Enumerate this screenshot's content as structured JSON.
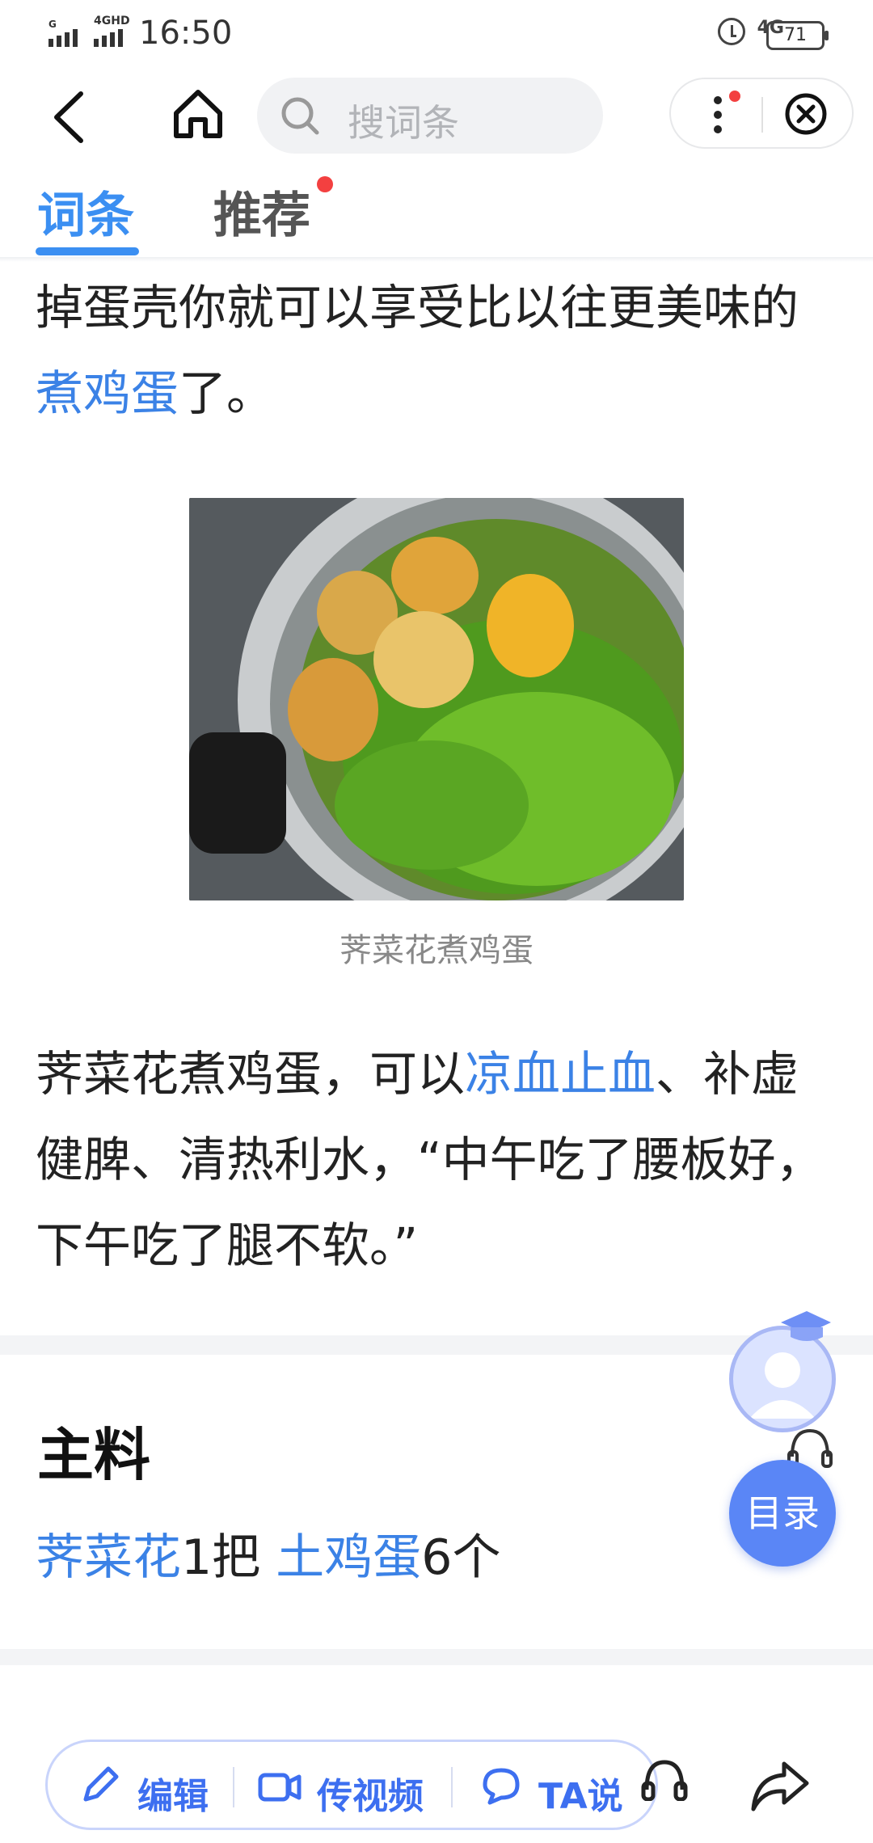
{
  "status_bar": {
    "time": "16:50",
    "signal_label": "4GHD",
    "network_label": "4G",
    "battery": "71"
  },
  "nav": {
    "search_placeholder": "搜词条"
  },
  "tabs": [
    {
      "label": "词条",
      "active": true
    },
    {
      "label": "推荐",
      "active": false,
      "has_dot": true
    }
  ],
  "article": {
    "para1_text": "掉蛋壳你就可以享受比以往更美味的",
    "para1_link": "煮鸡蛋",
    "para1_tail": "了。",
    "image_caption": "荠菜花煮鸡蛋",
    "para2_text_a": "荠菜花煮鸡蛋，可以",
    "para2_link": "凉血止血",
    "para2_text_b": "、补虚健脾、清热利水，“中午吃了腰板好，下午吃了腿不软。”"
  },
  "ingredients": {
    "title": "主料",
    "items": [
      {
        "name": "荠菜花",
        "amount": "1把"
      },
      {
        "name": "土鸡蛋",
        "amount": "6个"
      }
    ]
  },
  "floating": {
    "toc_label": "目录"
  },
  "bottom_bar": {
    "edit_label": "编辑",
    "video_label": "传视频",
    "ta_label": "TA说"
  },
  "colors": {
    "accent": "#3b8ff2",
    "link": "#3b82e6",
    "toc_button": "#5a86f6",
    "red_dot": "#f34040"
  }
}
